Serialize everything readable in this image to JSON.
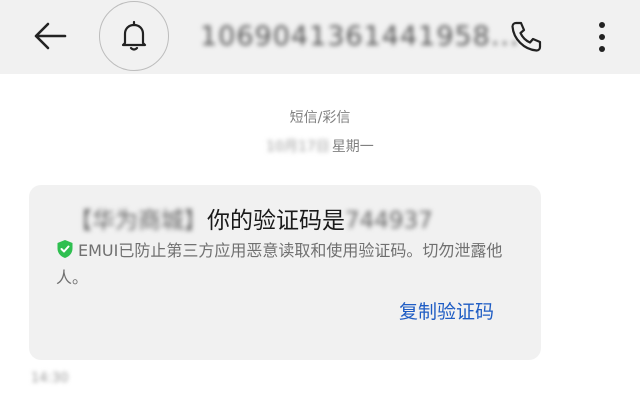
{
  "header": {
    "back_icon": "arrow-left-icon",
    "bell_icon": "bell-icon",
    "contact_number": "1069041361441958...",
    "phone_icon": "phone-icon",
    "more_icon": "more-vertical-icon"
  },
  "message_meta": {
    "type_label": "短信/彩信",
    "date_redacted": "10月17日",
    "weekday": "星期一"
  },
  "message": {
    "sender_tag_redacted": "【华为商城】",
    "code_prefix": "你的验证码是",
    "code_redacted": "744937",
    "notice": "EMUI已防止第三方应用恶意读取和使用验证码。切勿泄露他人。",
    "notice_icon": "shield-check-icon",
    "shield_color": "#2fbf50",
    "copy_button": "复制验证码",
    "accent_color": "#1f5dc4"
  },
  "footer": {
    "time_redacted": "14:30"
  }
}
